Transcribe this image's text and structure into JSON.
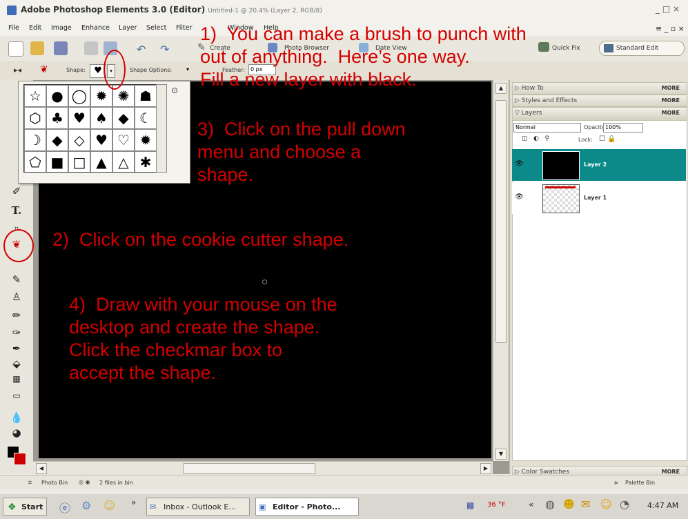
{
  "window": {
    "title": "Adobe Photoshop Elements 3.0 (Editor)",
    "subtitle": "Untitled-1 @ 20.4% (Layer 2, RGB/8)",
    "controls": "_ □ ×"
  },
  "menu": [
    "File",
    "Edit",
    "Image",
    "Enhance",
    "Layer",
    "Select",
    "Filter",
    "View",
    "Window",
    "Help"
  ],
  "shortcuts": {
    "create": "Create",
    "photo_browser": "Photo Browser",
    "date_view": "Date View",
    "quick_fix": "Quick Fix",
    "standard_edit": "Standard Edit"
  },
  "options": {
    "shape_label": "Shape:",
    "shape_options_label": "Shape Options:",
    "feather_label": "Feather:",
    "feather_value": "0 px"
  },
  "palettes": {
    "how_to": "How To",
    "styles_effects": "Styles and Effects",
    "layers": "Layers",
    "more": "MORE",
    "blend_mode": "Normal",
    "opacity_label": "Opacity:",
    "opacity_value": "100%",
    "lock_label": "Lock:",
    "layer2": "Layer 2",
    "layer1": "Layer 1",
    "color_swatches": "Color Swatches",
    "palette_bin": "Palette Bin"
  },
  "status": {
    "photo_bin": "Photo Bin",
    "files_in_bin": "2 files in bin"
  },
  "taskbar": {
    "start": "Start",
    "inbox": "Inbox - Outlook E...",
    "editor": "Editor - Photo...",
    "temp": "36 °F",
    "clock": "4:47 AM"
  },
  "notes": {
    "n1": "1)  You can make a brush to punch with\nout of anything.  Here’s one way.\nFill a new layer with black.",
    "n3": "3)  Click on the pull down\nmenu and choose a\nshape.",
    "n2": "2)  Click on the cookie cutter shape.",
    "n4": "4)  Draw with your mouse on the\ndesktop and create the shape.\nClick the checkmar box to\naccept the shape."
  },
  "shapes": [
    "☆",
    "●",
    "◯",
    "✹",
    "✺",
    "☗",
    "⬡",
    "♣",
    "♥",
    "♠",
    "◆",
    "☾",
    "☽",
    "◆",
    "◇",
    "♥",
    "♡",
    "✹",
    "⬠",
    "■",
    "□",
    "▲",
    "△",
    "✱"
  ],
  "colors": {
    "annotation": "#d40000",
    "layer_selected": "#0c8a8a",
    "canvas": "#000000"
  },
  "icons": [
    "cookie-cutter-icon",
    "type-icon",
    "brush-icon",
    "eraser-icon",
    "paint-bucket-icon",
    "gradient-icon",
    "sponge-icon"
  ]
}
